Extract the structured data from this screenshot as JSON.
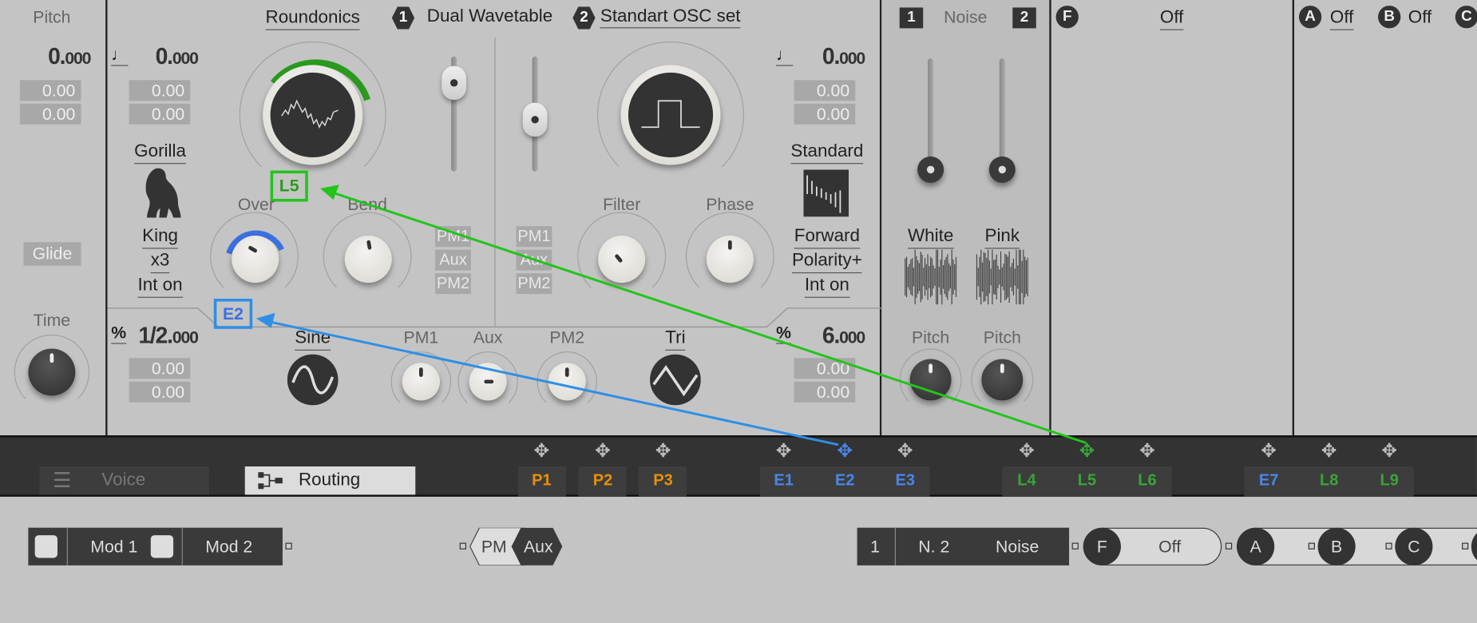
{
  "pitch_panel": {
    "title": "Pitch",
    "value_int": "0.",
    "value_frac": "000",
    "box1": "0.00",
    "box2": "0.00",
    "glide": "Glide",
    "time": "Time"
  },
  "header": {
    "preset": "Roundonics",
    "osc1_num": "1",
    "osc1_name": "Dual Wavetable",
    "osc2_num": "2",
    "osc2_name": "Standart OSC set"
  },
  "osc1": {
    "value_int": "0.",
    "value_frac": "000",
    "box1": "0.00",
    "box2": "0.00",
    "wave_name": "Gorilla",
    "sub1": "King",
    "sub2": "x3",
    "sub3": "Int on",
    "over": "Over",
    "bend": "Bend",
    "tags": [
      "PM1",
      "Aux",
      "PM2"
    ]
  },
  "osc2": {
    "value_int": "0.",
    "value_frac": "000",
    "box1": "0.00",
    "box2": "0.00",
    "mode": "Standard",
    "sub1": "Forward",
    "sub2": "Polarity+",
    "sub3": "Int on",
    "filter": "Filter",
    "phase": "Phase",
    "tags": [
      "PM1",
      "Aux",
      "PM2"
    ]
  },
  "mod_section": {
    "left_int": "1/2.",
    "left_frac": "000",
    "left_box1": "0.00",
    "left_box2": "0.00",
    "sine": "Sine",
    "pm1": "PM1",
    "aux": "Aux",
    "pm2": "PM2",
    "tri": "Tri",
    "right_int": "6.",
    "right_frac": "000",
    "right_box1": "0.00",
    "right_box2": "0.00",
    "percent": "%"
  },
  "mod_assignments": {
    "l5": "L5",
    "e2": "E2"
  },
  "noise": {
    "tag1": "1",
    "title": "Noise",
    "tag2": "2",
    "white": "White",
    "pink": "Pink",
    "pitch1": "Pitch",
    "pitch2": "Pitch"
  },
  "filter_panel": {
    "letter": "F",
    "value": "Off"
  },
  "fx_panel": {
    "a": "A",
    "a_value": "Off",
    "b": "B",
    "b_value": "Off",
    "c": "C"
  },
  "tabs": {
    "voice": "Voice",
    "routing": "Routing",
    "active": "Routing"
  },
  "modulators": [
    {
      "label": "P1",
      "color": "#e8900a"
    },
    {
      "label": "P2",
      "color": "#e8900a"
    },
    {
      "label": "P3",
      "color": "#e8900a"
    },
    {
      "label": "E1",
      "color": "#4a86e8"
    },
    {
      "label": "E2",
      "color": "#4a86e8"
    },
    {
      "label": "E3",
      "color": "#4a86e8"
    },
    {
      "label": "L4",
      "color": "#3aa53a"
    },
    {
      "label": "L5",
      "color": "#3aa53a"
    },
    {
      "label": "L6",
      "color": "#3aa53a"
    },
    {
      "label": "E7",
      "color": "#4a86e8"
    },
    {
      "label": "L8",
      "color": "#3aa53a"
    },
    {
      "label": "L9",
      "color": "#3aa53a"
    }
  ],
  "routing": {
    "mod1": "Mod 1",
    "mod2": "Mod 2",
    "pm": "PM",
    "aux": "Aux",
    "n1": "1",
    "n2": "N. 2",
    "noise": "Noise",
    "f": "F",
    "f_off": "Off",
    "a": "A",
    "b": "B",
    "c": "C"
  },
  "colors": {
    "green": "#22c41a",
    "blue": "#2e8fe6",
    "panel": "#c4c4c4",
    "dark": "#333333"
  }
}
